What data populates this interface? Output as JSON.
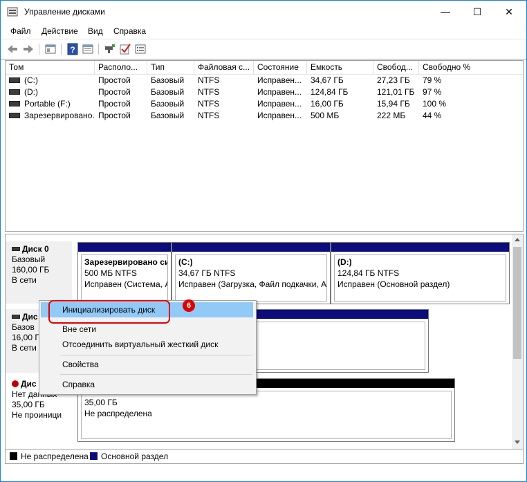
{
  "window": {
    "title": "Управление дисками",
    "minimize_glyph": "—",
    "maximize_glyph": "☐",
    "close_glyph": "✕"
  },
  "menu": [
    "Файл",
    "Действие",
    "Вид",
    "Справка"
  ],
  "toolbar": {
    "icons": [
      "back-icon",
      "forward-icon",
      "show-hide-tree-icon",
      "help-icon",
      "properties-icon",
      "connect-icon",
      "check-icon",
      "list-icon"
    ]
  },
  "volumes": {
    "columns": [
      "Том",
      "Располо...",
      "Тип",
      "Файловая с...",
      "Состояние",
      "Емкость",
      "Свобод...",
      "Свободно %"
    ],
    "rows": [
      [
        "(C:)",
        "Простой",
        "Базовый",
        "NTFS",
        "Исправен...",
        "34,67 ГБ",
        "27,23 ГБ",
        "79 %"
      ],
      [
        "(D:)",
        "Простой",
        "Базовый",
        "NTFS",
        "Исправен...",
        "124,84 ГБ",
        "121,01 ГБ",
        "97 %"
      ],
      [
        "Portable (F:)",
        "Простой",
        "Базовый",
        "NTFS",
        "Исправен...",
        "16,00 ГБ",
        "15,94 ГБ",
        "100 %"
      ],
      [
        "Зарезервировано...",
        "Простой",
        "Базовый",
        "NTFS",
        "Исправен...",
        "500 МБ",
        "222 МБ",
        "44 %"
      ]
    ]
  },
  "disks": [
    {
      "name": "Диск 0",
      "type": "Базовый",
      "size": "160,00 ГБ",
      "status": "В сети",
      "partitions": [
        {
          "title": "Зарезервировано си",
          "line1": "500 МБ NTFS",
          "line2": "Исправен (Система, А"
        },
        {
          "title": "(C:)",
          "line1": "34,67 ГБ NTFS",
          "line2": "Исправен (Загрузка, Файл подкачки, А"
        },
        {
          "title": "(D:)",
          "line1": "124,84 ГБ NTFS",
          "line2": "Исправен (Основной раздел)"
        }
      ]
    },
    {
      "name": "Дис",
      "type": "Базов",
      "size": "16,00 Г",
      "status": "В сети"
    },
    {
      "name": "Дис",
      "type": "Нет данных",
      "size": "35,00 ГБ",
      "status": "Не проиници",
      "partition": {
        "line1": "35,00 ГБ",
        "line2": "Не распределена"
      }
    }
  ],
  "legend": [
    {
      "label": "Не распределена",
      "color": "#000000"
    },
    {
      "label": "Основной раздел",
      "color": "#0c0c7a"
    }
  ],
  "context_menu": {
    "items": [
      "Инициализировать диск",
      "Вне сети",
      "Отсоединить виртуальный жесткий диск",
      "Свойства",
      "Справка"
    ],
    "badge": "6"
  }
}
